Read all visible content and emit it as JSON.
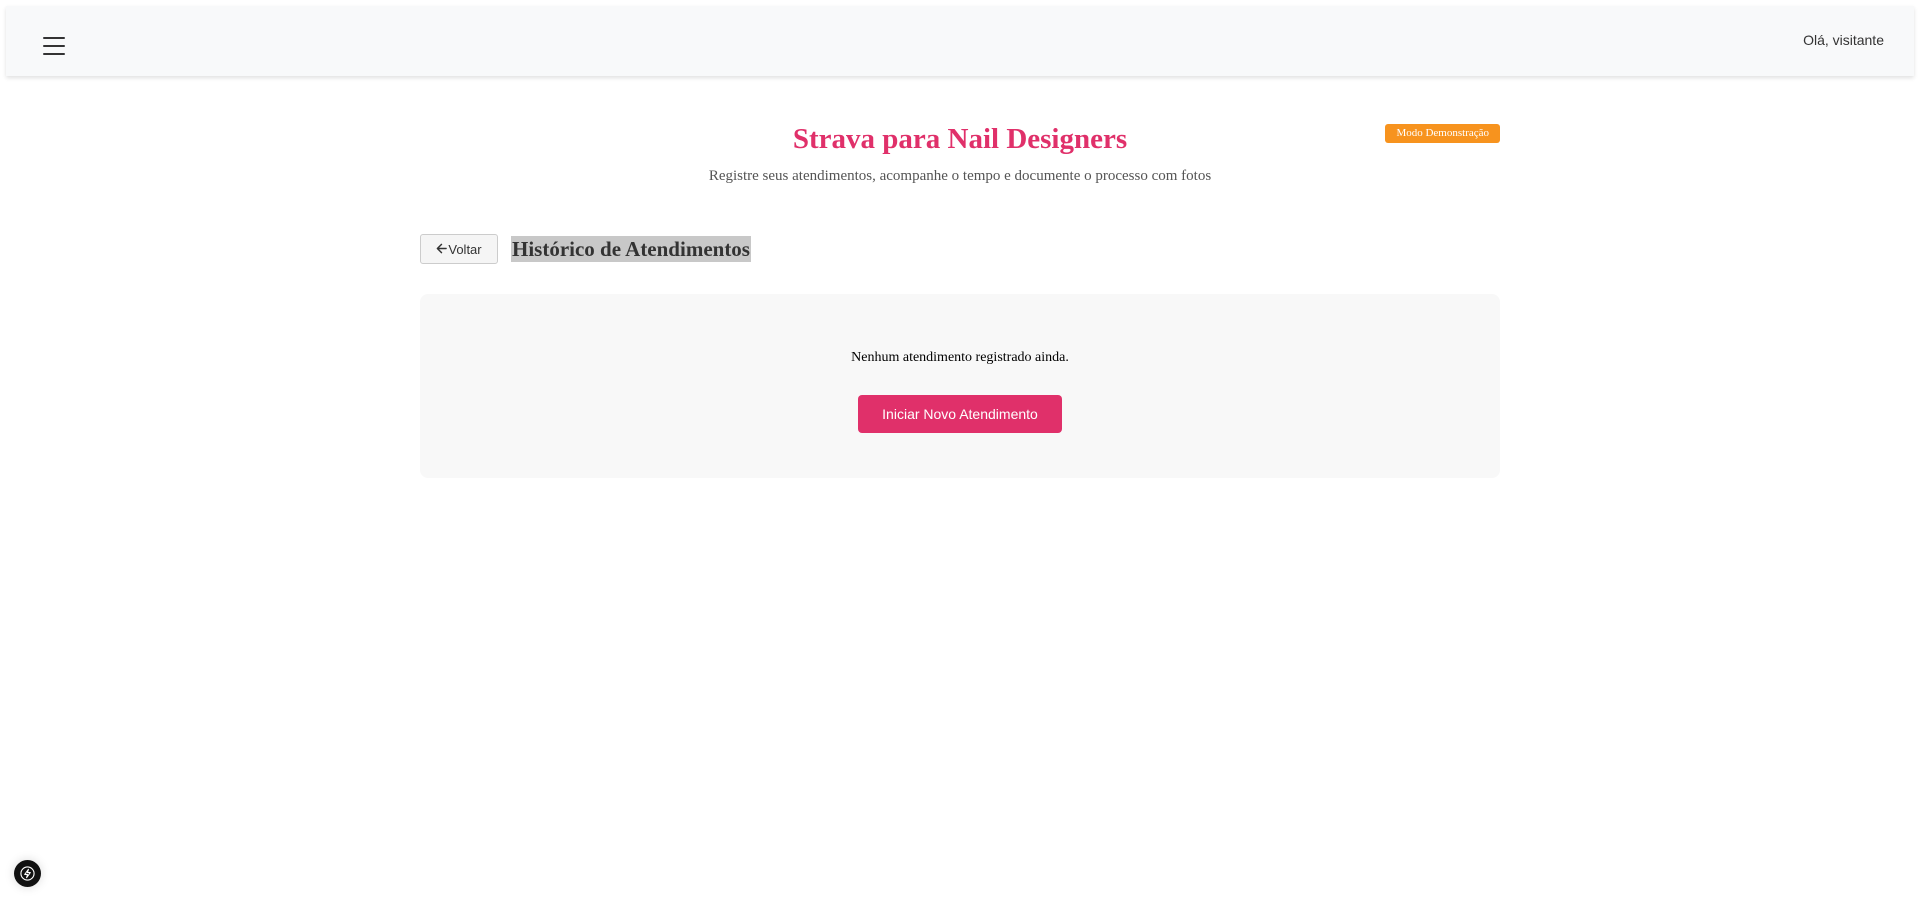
{
  "header": {
    "menu_icon": "hamburger-menu-icon",
    "greeting": "Olá, visitante"
  },
  "app": {
    "title": "Strava para Nail Designers",
    "subtitle": "Registre seus atendimentos, acompanhe o tempo e documente o processo com fotos",
    "demo_badge": "Modo Demonstração"
  },
  "history": {
    "back_label": "Voltar",
    "back_icon": "arrow-left-icon",
    "title": "Histórico de Atendimentos",
    "empty_message": "Nenhum atendimento registrado ainda.",
    "start_button": "Iniciar Novo Atendimento"
  },
  "floating": {
    "icon": "lightning-bolt-icon"
  },
  "colors": {
    "accent": "#e0306a",
    "badge": "#f7931e",
    "topbar_bg": "#f8f9fa",
    "card_bg": "#f8f8f8"
  }
}
